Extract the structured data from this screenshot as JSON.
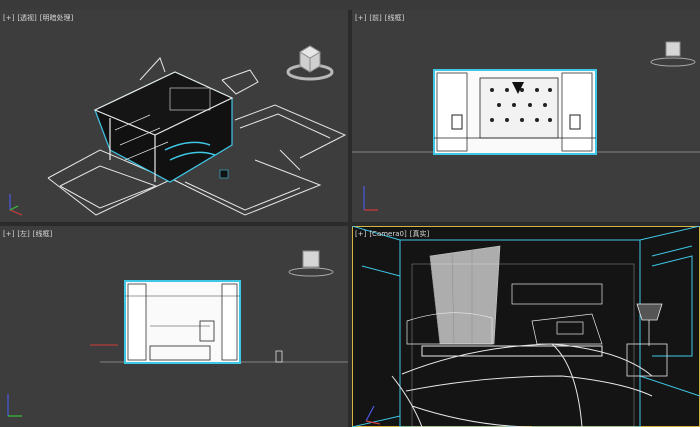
{
  "window": {
    "toolbar_strip": ""
  },
  "viewports": {
    "perspective": {
      "plus": "[+]",
      "view": "[透视]",
      "shading": "[明暗处理]"
    },
    "front": {
      "plus": "[+]",
      "view": "[前]",
      "shading": "[线框]"
    },
    "left": {
      "plus": "[+]",
      "view": "[左]",
      "shading": "[线框]"
    },
    "camera": {
      "plus": "[+]",
      "view": "[Camera0]",
      "shading": "[真实]"
    }
  },
  "icons": {
    "viewcube": "viewcube-icon",
    "axis_tripod": "axis-tripod-icon"
  },
  "colors": {
    "viewport_bg": "#3d3d3d",
    "active_border": "#d6b444",
    "wire_cyan": "#3fc7e6",
    "wire_white": "#e8e8e8",
    "axis_x": "#d23a3a",
    "axis_y": "#3ac23a",
    "axis_z": "#4a5ae0"
  }
}
